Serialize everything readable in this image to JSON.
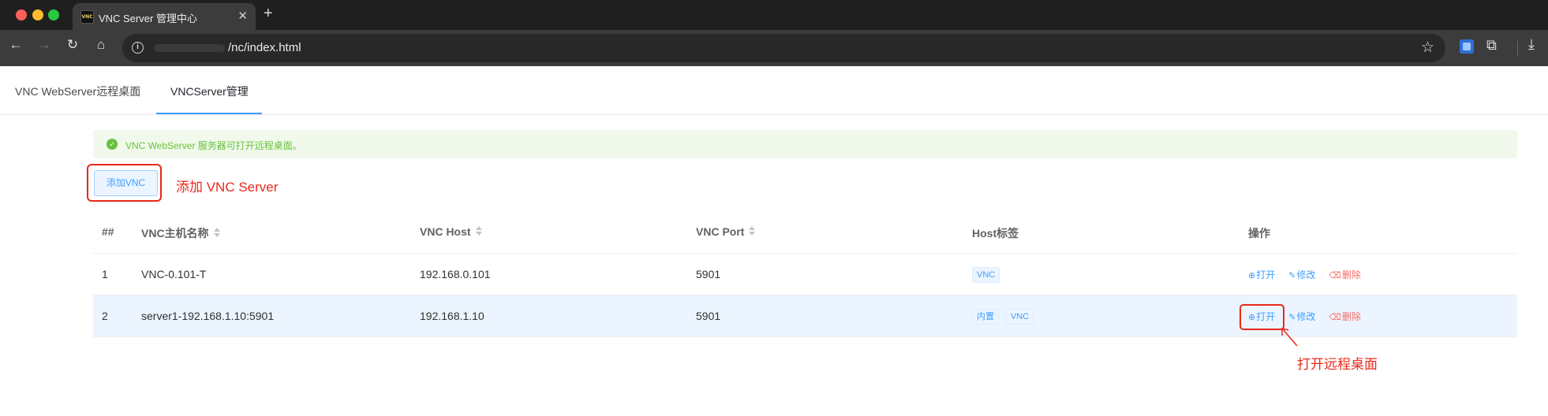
{
  "browser": {
    "tab_title": "VNC Server 管理中心",
    "favicon_text": "VNC",
    "tab_close": "✕",
    "new_tab": "+",
    "url": "/nc/index.html"
  },
  "page_tabs": {
    "tab1": "VNC WebServer远程桌面",
    "tab2": "VNCServer管理"
  },
  "alert": {
    "text": "VNC WebServer 服务器可打开远程桌面。",
    "status_color": "#67c23a"
  },
  "toolbar": {
    "add_label": "添加VNC"
  },
  "annotations": {
    "add_note": "添加 VNC Server",
    "open_note": "打开远程桌面",
    "color": "#e8291b"
  },
  "table": {
    "headers": {
      "index": "##",
      "name": "VNC主机名称",
      "host": "VNC Host",
      "port": "VNC Port",
      "tags": "Host标签",
      "actions": "操作"
    },
    "rows": [
      {
        "index": "1",
        "name": "VNC-0.101-T",
        "host": "192.168.0.101",
        "port": "5901",
        "tags": [
          "VNC"
        ]
      },
      {
        "index": "2",
        "name": "server1-192.168.1.10:5901",
        "host": "192.168.1.10",
        "port": "5901",
        "tags": [
          "内置",
          "VNC"
        ]
      }
    ],
    "actions": {
      "open": "打开",
      "edit": "修改",
      "delete": "删除"
    }
  },
  "colors": {
    "primary": "#409eff",
    "danger": "#f56c6c"
  }
}
